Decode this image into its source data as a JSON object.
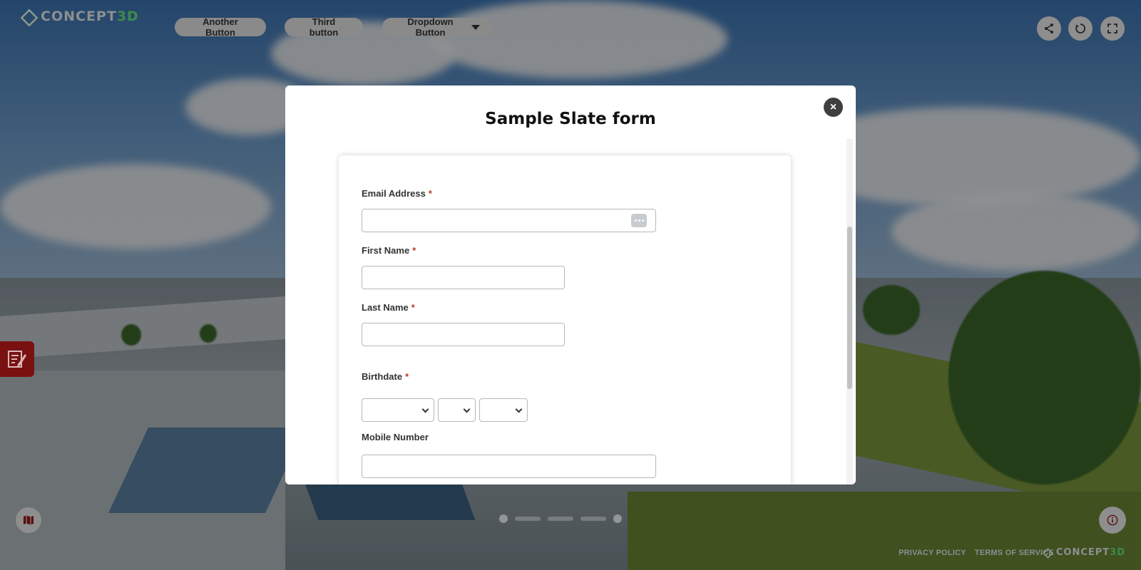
{
  "app": {
    "logo_prefix": "CONCEPT",
    "logo_accent": "3D",
    "brand_color": "#3e8a4e"
  },
  "toolbar": {
    "buttons": [
      {
        "label": "Another Button"
      },
      {
        "label": "Third button"
      },
      {
        "label": "Dropdown Button"
      }
    ],
    "icons": [
      "share-icon",
      "rotate-icon",
      "fullscreen-icon"
    ]
  },
  "modal": {
    "title": "Sample Slate form",
    "close_label": "×"
  },
  "form": {
    "required_marker": "*",
    "email_label": "Email Address",
    "first_name_label": "First Name",
    "last_name_label": "Last Name",
    "birthdate_label": "Birthdate",
    "mobile_label": "Mobile Number"
  },
  "footer": {
    "privacy": "PRIVACY POLICY",
    "terms": "TERMS OF SERVICE"
  }
}
